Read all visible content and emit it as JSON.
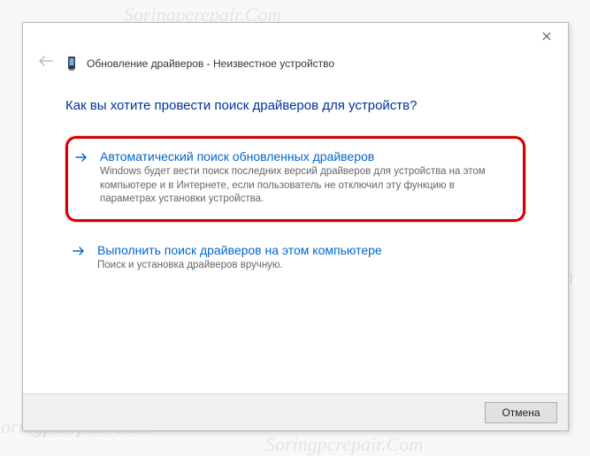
{
  "watermark": "Soringpcrepair.Com",
  "dialog": {
    "title": "Обновление драйверов - Неизвестное устройство",
    "heading": "Как вы хотите провести поиск драйверов для устройств?",
    "options": [
      {
        "title": "Автоматический поиск обновленных драйверов",
        "desc": "Windows будет вести поиск последних версий драйверов для устройства на этом компьютере и в Интернете, если пользователь не отключил эту функцию в параметрах установки устройства.",
        "highlighted": true
      },
      {
        "title": "Выполнить поиск драйверов на этом компьютере",
        "desc": "Поиск и установка драйверов вручную.",
        "highlighted": false
      }
    ],
    "cancel_label": "Отмена"
  }
}
